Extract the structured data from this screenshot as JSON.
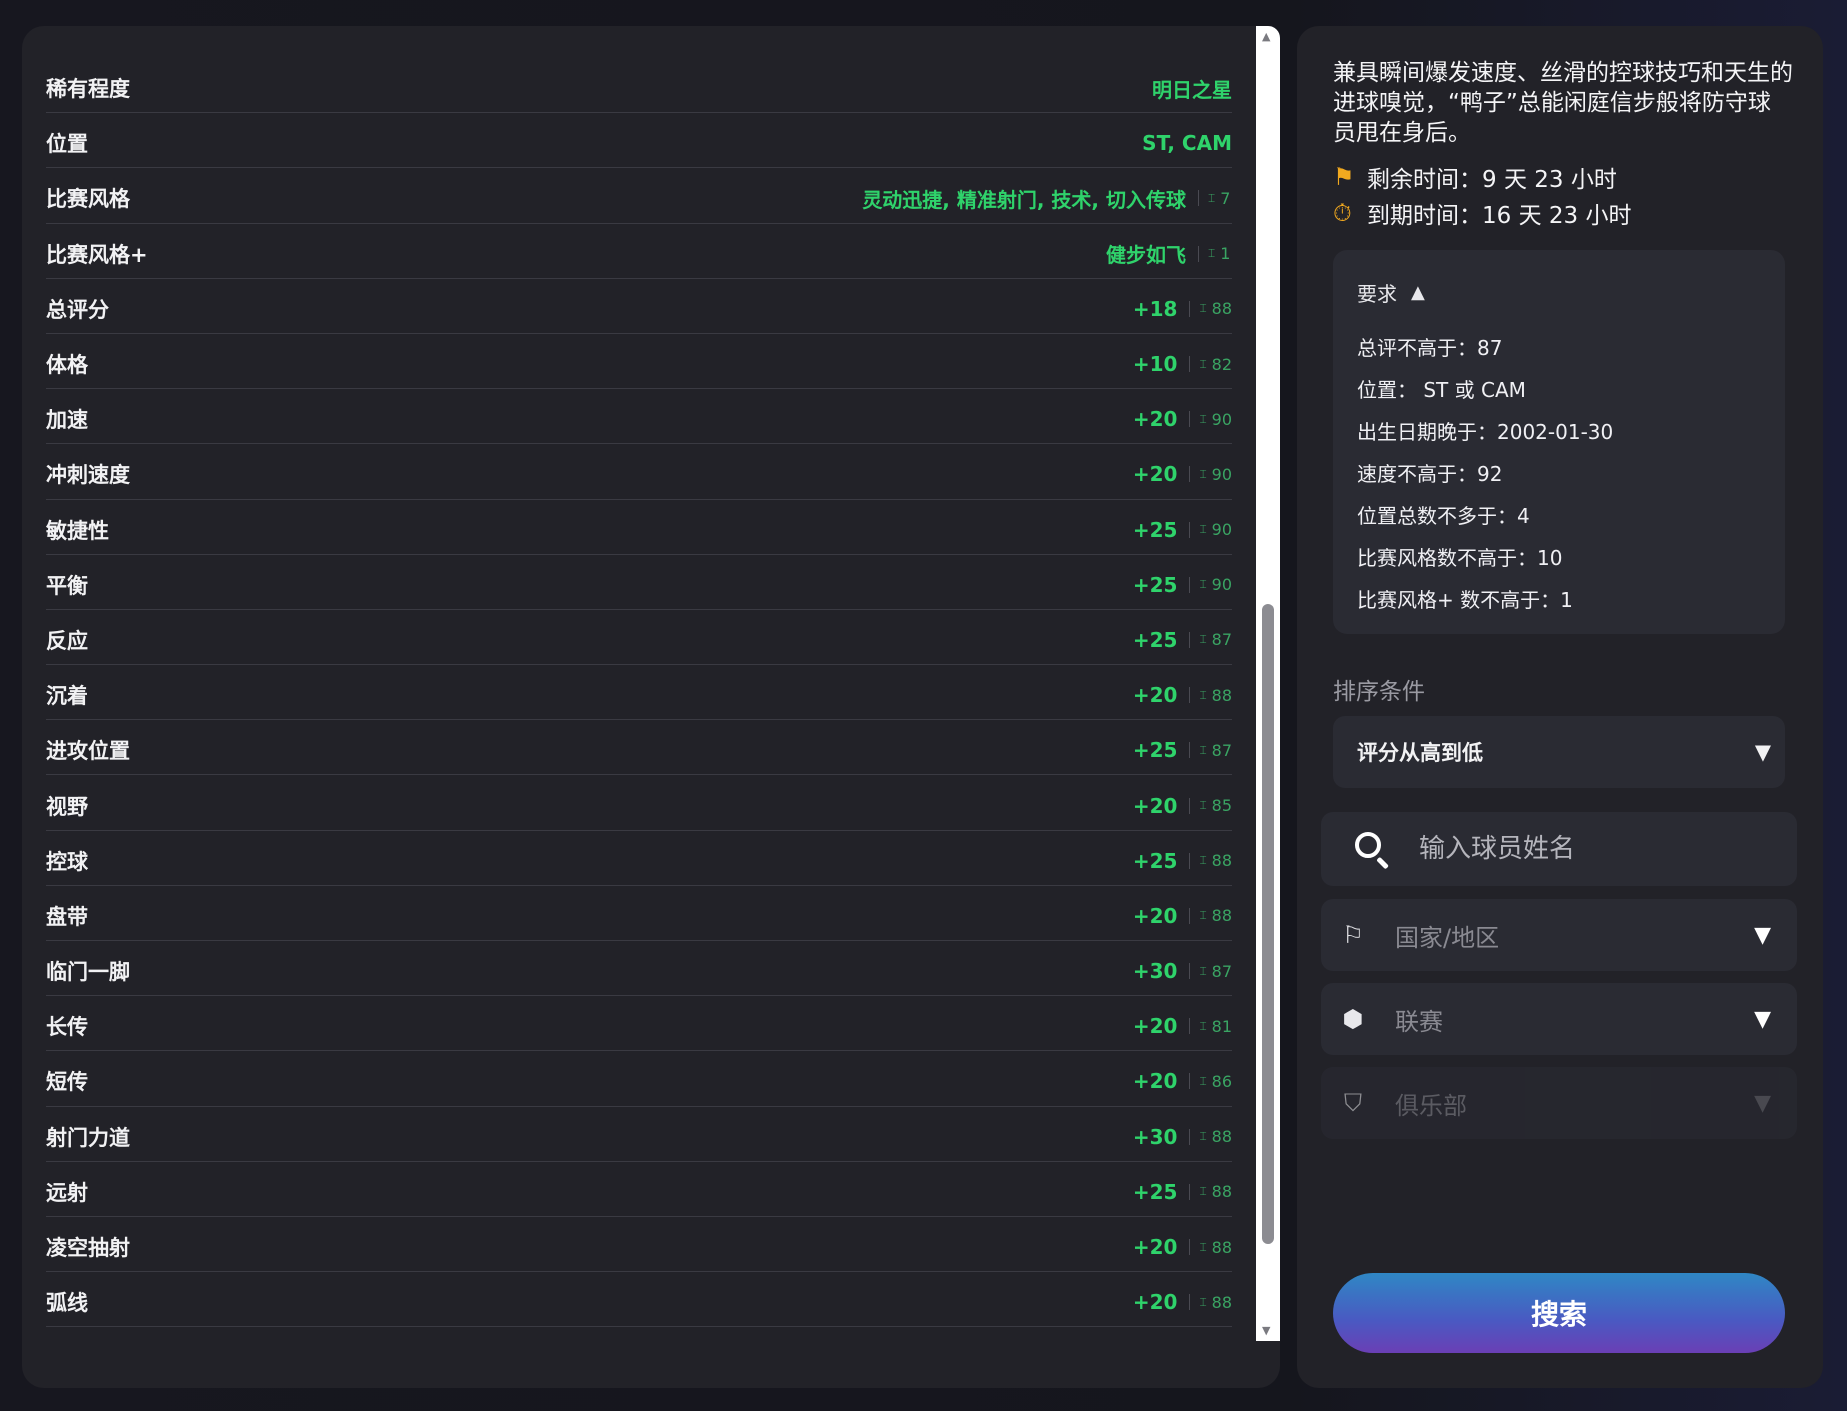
{
  "left": {
    "rows": [
      {
        "label": "稀有程度",
        "value": "明日之星",
        "cap": ""
      },
      {
        "label": "位置",
        "value": "ST, CAM",
        "cap": ""
      },
      {
        "label": "比赛风格",
        "value": "灵动迅捷, 精准射门, 技术, 切入传球",
        "cap": "7"
      },
      {
        "label": "比赛风格+",
        "value": "健步如飞",
        "cap": "1"
      },
      {
        "label": "总评分",
        "value": "+18",
        "cap": "88"
      },
      {
        "label": "体格",
        "value": "+10",
        "cap": "82"
      },
      {
        "label": "加速",
        "value": "+20",
        "cap": "90"
      },
      {
        "label": "冲刺速度",
        "value": "+20",
        "cap": "90"
      },
      {
        "label": "敏捷性",
        "value": "+25",
        "cap": "90"
      },
      {
        "label": "平衡",
        "value": "+25",
        "cap": "90"
      },
      {
        "label": "反应",
        "value": "+25",
        "cap": "87"
      },
      {
        "label": "沉着",
        "value": "+20",
        "cap": "88"
      },
      {
        "label": "进攻位置",
        "value": "+25",
        "cap": "87"
      },
      {
        "label": "视野",
        "value": "+20",
        "cap": "85"
      },
      {
        "label": "控球",
        "value": "+25",
        "cap": "88"
      },
      {
        "label": "盘带",
        "value": "+20",
        "cap": "88"
      },
      {
        "label": "临门一脚",
        "value": "+30",
        "cap": "87"
      },
      {
        "label": "长传",
        "value": "+20",
        "cap": "81"
      },
      {
        "label": "短传",
        "value": "+20",
        "cap": "86"
      },
      {
        "label": "射门力道",
        "value": "+30",
        "cap": "88"
      },
      {
        "label": "远射",
        "value": "+25",
        "cap": "88"
      },
      {
        "label": "凌空抽射",
        "value": "+20",
        "cap": "88"
      },
      {
        "label": "弧线",
        "value": "+20",
        "cap": "88"
      }
    ]
  },
  "right": {
    "description": "兼具瞬间爆发速度、丝滑的控球技巧和天生的进球嗅觉，“鸭子”总能闲庭信步般将防守球员甩在身后。",
    "remaining": "剩余时间：9 天 23 小时",
    "expires": "到期时间：16 天 23 小时",
    "requirements": {
      "title": "要求",
      "items": [
        "总评不高于：87",
        "位置： ST 或 CAM",
        "出生日期晚于：2002-01-30",
        "速度不高于：92",
        "位置总数不多于：4",
        "比赛风格数不高于：10",
        "比赛风格+ 数不高于：1"
      ]
    },
    "sort_label": "排序条件",
    "sort_value": "评分从高到低",
    "search_placeholder": "输入球员姓名",
    "filters": {
      "nation": "国家/地区",
      "league": "联赛",
      "club": "俱乐部"
    },
    "search_button": "搜索"
  },
  "colors": {
    "panel": "#222228",
    "accent_green": "#2fd36b",
    "timer_icon": "#f2a91f"
  }
}
